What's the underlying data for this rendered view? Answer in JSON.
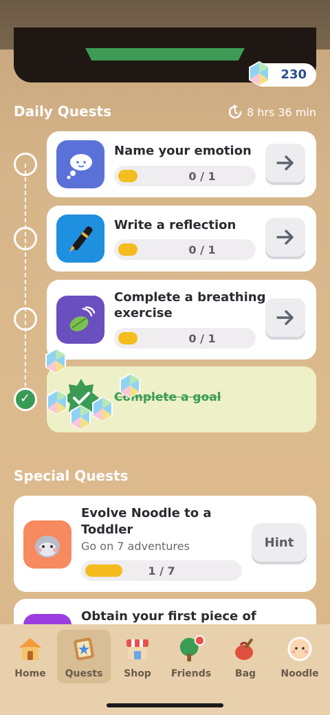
{
  "header": {
    "gem_count": "230"
  },
  "daily": {
    "title": "Daily Quests",
    "timer": "8 hrs 36 min",
    "quests": [
      {
        "title": "Name your emotion",
        "progress": "0 / 1",
        "progress_fraction": 0
      },
      {
        "title": "Write a reflection",
        "progress": "0 / 1",
        "progress_fraction": 0
      },
      {
        "title_line1": "Complete a breathing",
        "title_line2": "exercise",
        "progress": "0 / 1",
        "progress_fraction": 0
      }
    ],
    "completed": {
      "title": "Complete a goal"
    }
  },
  "special": {
    "title": "Special Quests",
    "quests": [
      {
        "title_line1": "Evolve Noodle to a",
        "title_line2": "Toddler",
        "subtitle": "Go on 7 adventures",
        "progress": "1 / 7",
        "progress_fraction": 0.14,
        "hint_label": "Hint"
      },
      {
        "title_line1": "Obtain your first piece of"
      }
    ]
  },
  "nav": {
    "items": [
      {
        "label": "Home",
        "icon": "house-icon"
      },
      {
        "label": "Quests",
        "icon": "quest-book-icon"
      },
      {
        "label": "Shop",
        "icon": "shop-icon"
      },
      {
        "label": "Friends",
        "icon": "tree-icon"
      },
      {
        "label": "Bag",
        "icon": "bag-icon"
      },
      {
        "label": "Noodle",
        "icon": "noodle-face-icon"
      }
    ],
    "active": "Quests"
  },
  "colors": {
    "accent_green": "#3a9b55",
    "progress_yellow": "#f4bc1e",
    "gem_blue": "#2d4c8c"
  }
}
